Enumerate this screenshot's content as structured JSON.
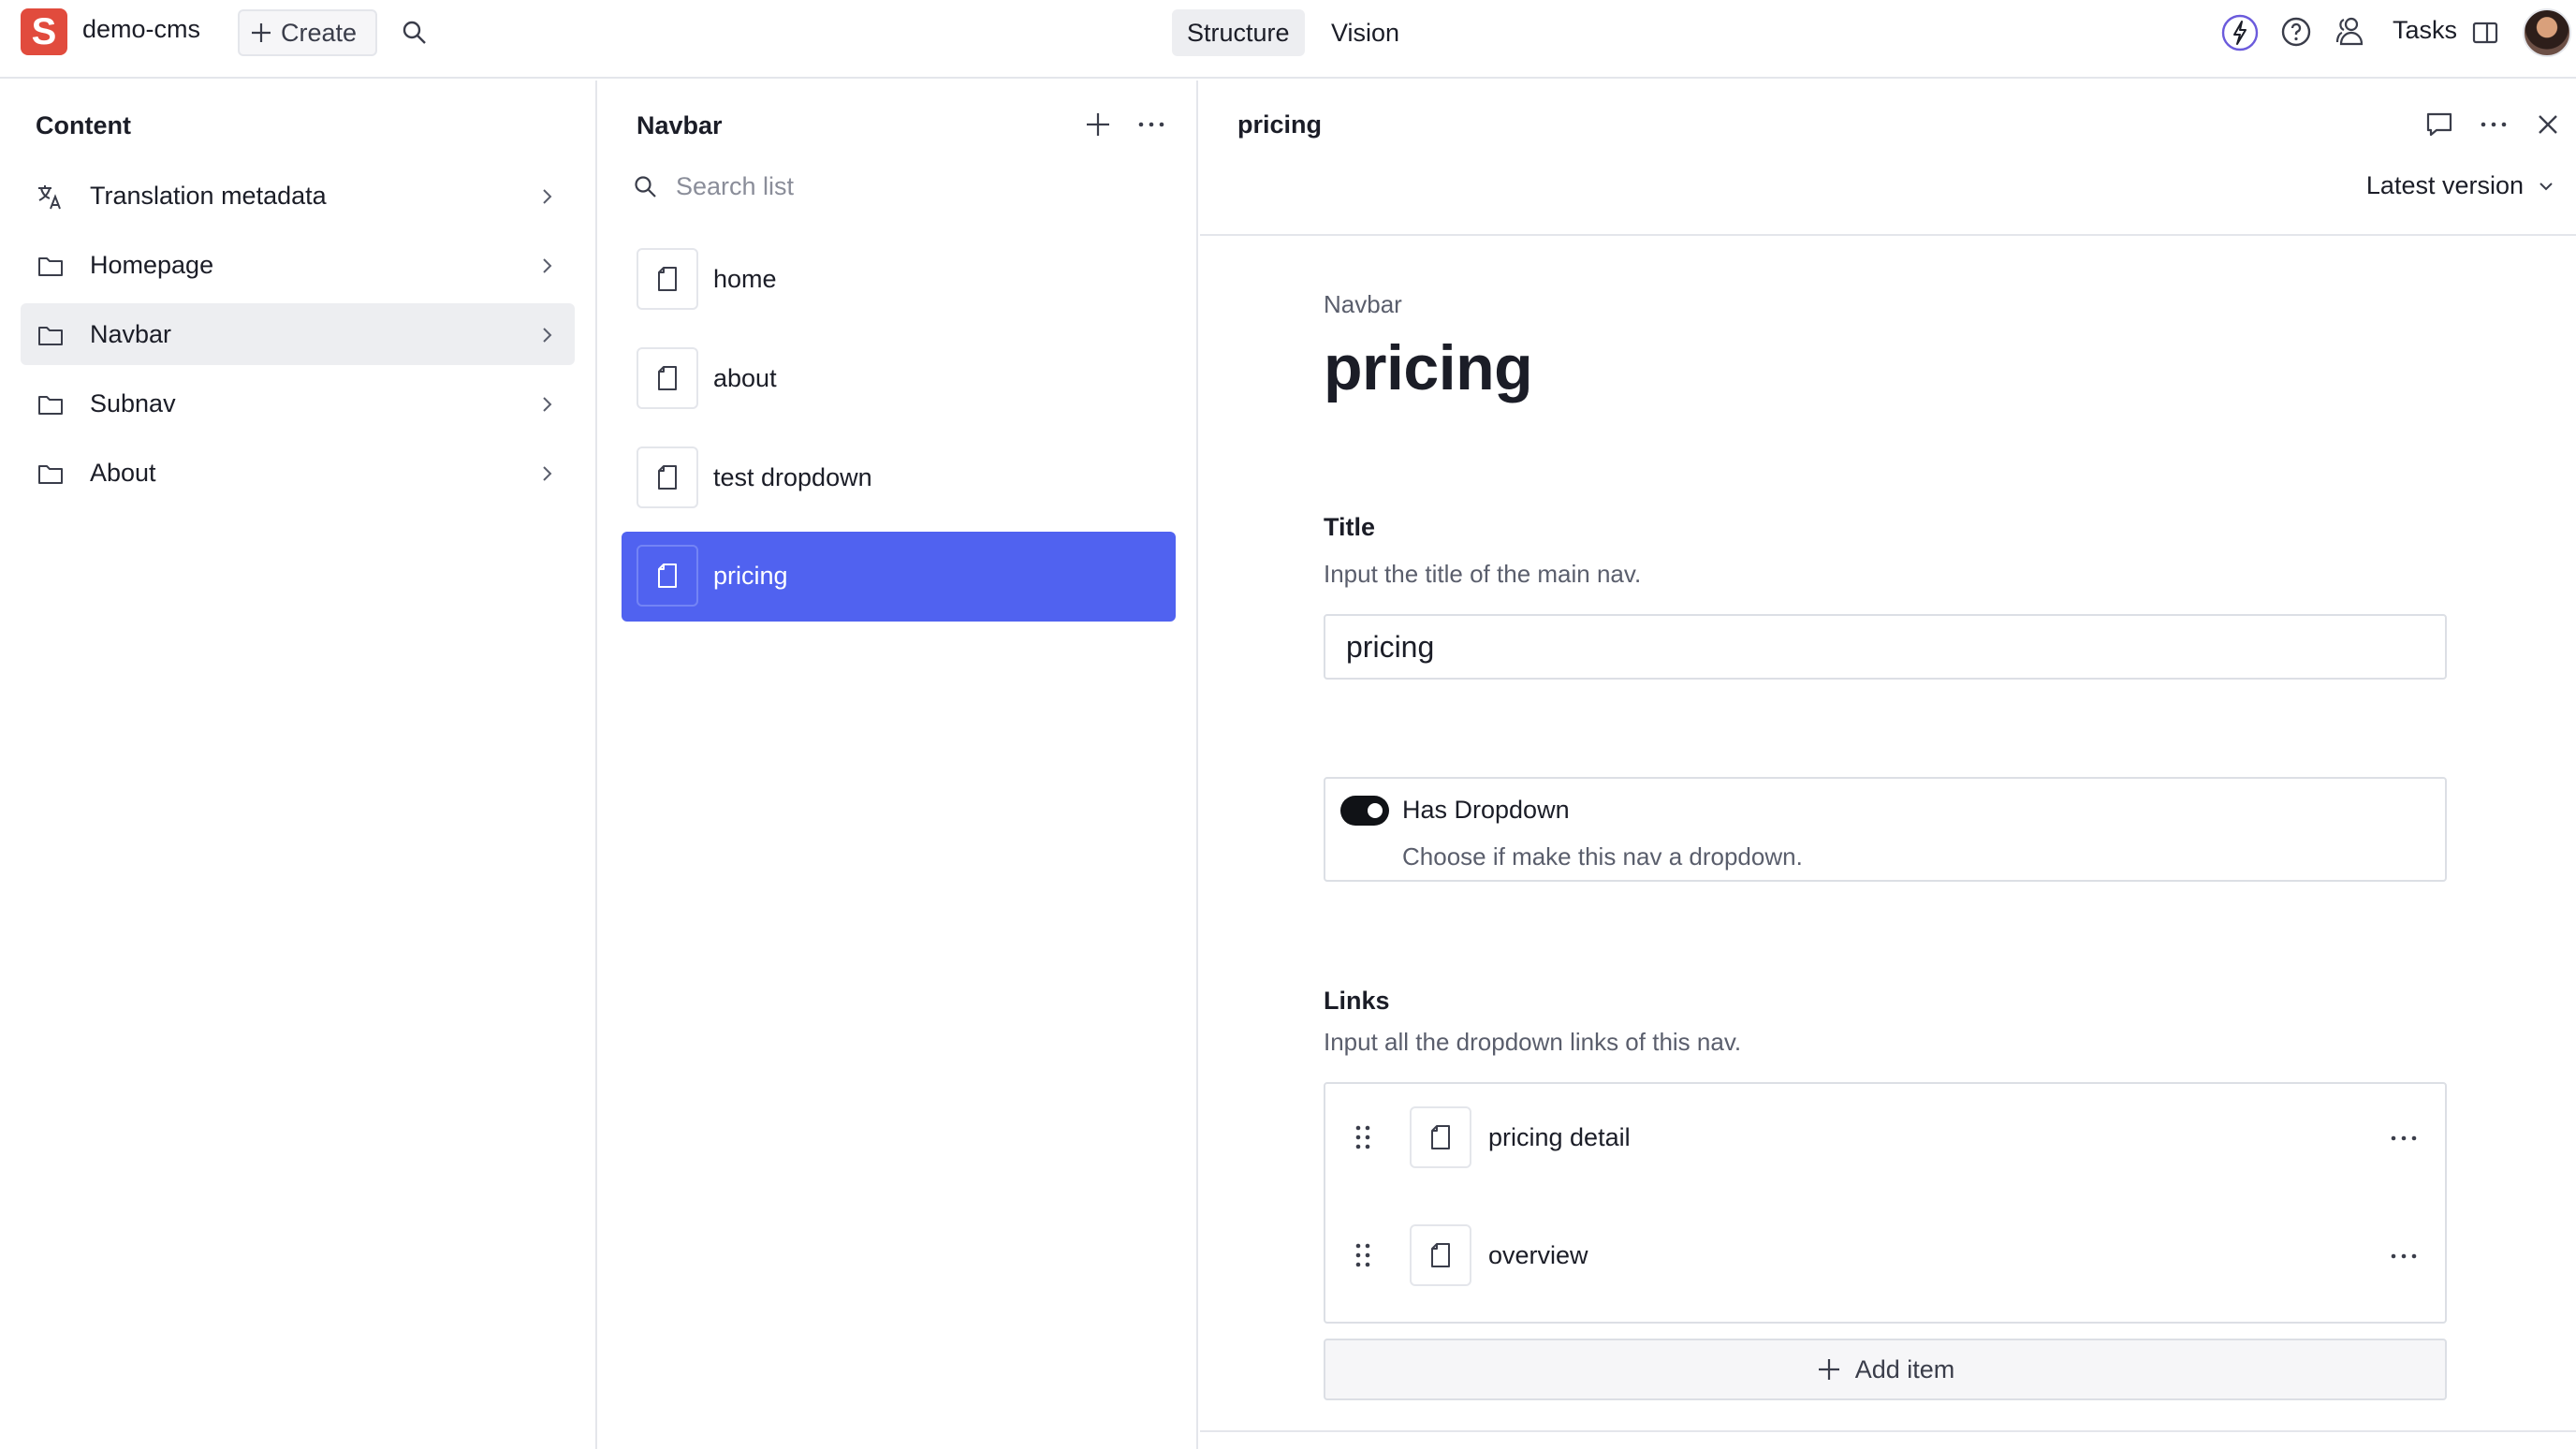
{
  "topbar": {
    "project_name": "demo-cms",
    "create_label": "Create",
    "tools": [
      {
        "label": "Structure",
        "active": true
      },
      {
        "label": "Vision",
        "active": false
      }
    ],
    "tasks_label": "Tasks"
  },
  "content_pane": {
    "title": "Content",
    "items": [
      {
        "label": "Translation metadata",
        "icon": "translate-icon",
        "active": false
      },
      {
        "label": "Homepage",
        "icon": "folder-icon",
        "active": false
      },
      {
        "label": "Navbar",
        "icon": "folder-icon",
        "active": true
      },
      {
        "label": "Subnav",
        "icon": "folder-icon",
        "active": false
      },
      {
        "label": "About",
        "icon": "folder-icon",
        "active": false
      }
    ]
  },
  "navbar_pane": {
    "title": "Navbar",
    "search_placeholder": "Search list",
    "documents": [
      {
        "label": "home",
        "selected": false
      },
      {
        "label": "about",
        "selected": false
      },
      {
        "label": "test dropdown",
        "selected": false
      },
      {
        "label": "pricing",
        "selected": true
      }
    ]
  },
  "document_pane": {
    "header_title": "pricing",
    "version_label": "Latest version",
    "breadcrumb": "Navbar",
    "title": "pricing",
    "fields": {
      "title_label": "Title",
      "title_description": "Input the title of the main nav.",
      "title_value": "pricing",
      "dropdown_label": "Has Dropdown",
      "dropdown_description": "Choose if make this nav a dropdown.",
      "dropdown_enabled": true,
      "links_label": "Links",
      "links_description": "Input all the dropdown links of this nav.",
      "links": [
        {
          "label": "pricing detail"
        },
        {
          "label": "overview"
        }
      ],
      "add_item_label": "Add item"
    }
  },
  "colors": {
    "brand": "#e14b3d",
    "selection": "#5062f0",
    "active_bg": "#edeef1",
    "toggle_on": "#101216"
  }
}
